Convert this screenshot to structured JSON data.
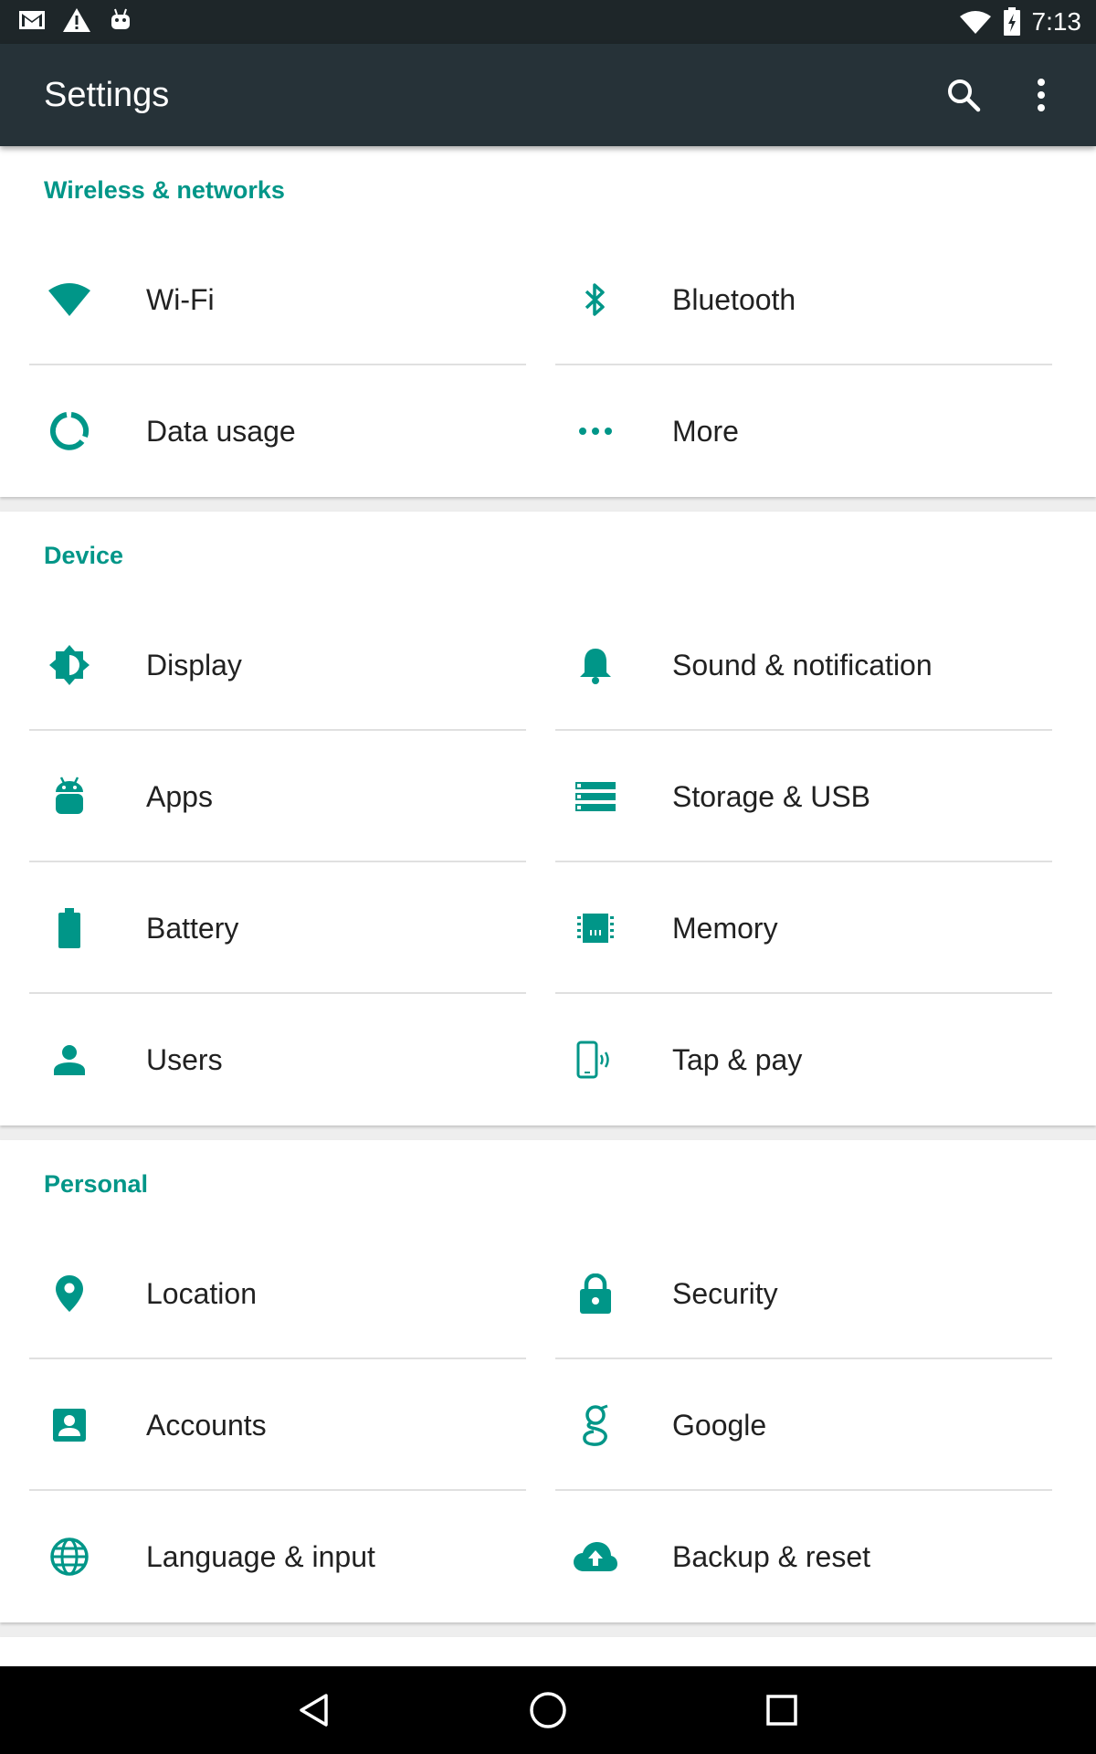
{
  "status_bar": {
    "time": "7:13",
    "left_icons": [
      "gmail-icon",
      "warning-icon",
      "android-debug-icon"
    ],
    "right_icons": [
      "wifi-signal-icon",
      "battery-charging-icon"
    ]
  },
  "toolbar": {
    "title": "Settings",
    "search_icon": "search-icon",
    "overflow_icon": "more-vert-icon"
  },
  "colors": {
    "accent": "#009688",
    "toolbar": "#263238",
    "status_bar": "#1e2629",
    "background": "#eeeeee"
  },
  "sections": [
    {
      "title": "Wireless & networks",
      "items": [
        {
          "label": "Wi-Fi",
          "icon": "wifi-icon"
        },
        {
          "label": "Bluetooth",
          "icon": "bluetooth-icon"
        },
        {
          "label": "Data usage",
          "icon": "data-usage-icon"
        },
        {
          "label": "More",
          "icon": "more-horiz-icon"
        }
      ]
    },
    {
      "title": "Device",
      "items": [
        {
          "label": "Display",
          "icon": "brightness-icon"
        },
        {
          "label": "Sound & notification",
          "icon": "bell-icon"
        },
        {
          "label": "Apps",
          "icon": "android-icon"
        },
        {
          "label": "Storage & USB",
          "icon": "storage-icon"
        },
        {
          "label": "Battery",
          "icon": "battery-icon"
        },
        {
          "label": "Memory",
          "icon": "memory-chip-icon"
        },
        {
          "label": "Users",
          "icon": "person-icon"
        },
        {
          "label": "Tap & pay",
          "icon": "tap-pay-icon"
        }
      ]
    },
    {
      "title": "Personal",
      "items": [
        {
          "label": "Location",
          "icon": "location-pin-icon"
        },
        {
          "label": "Security",
          "icon": "lock-icon"
        },
        {
          "label": "Accounts",
          "icon": "account-box-icon"
        },
        {
          "label": "Google",
          "icon": "google-g-icon"
        },
        {
          "label": "Language & input",
          "icon": "globe-icon"
        },
        {
          "label": "Backup & reset",
          "icon": "cloud-upload-icon"
        }
      ]
    }
  ],
  "nav_bar": {
    "buttons": [
      "back-icon",
      "home-icon",
      "recents-icon"
    ]
  }
}
